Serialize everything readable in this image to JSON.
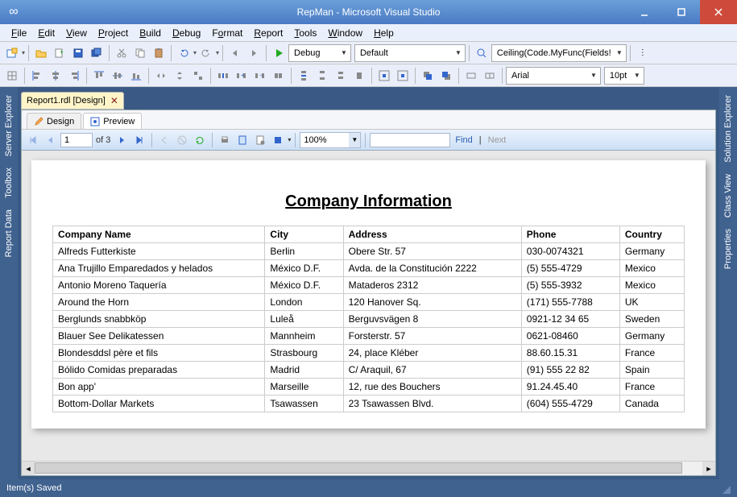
{
  "window": {
    "title": "RepMan - Microsoft Visual Studio"
  },
  "menu": [
    "File",
    "Edit",
    "View",
    "Project",
    "Build",
    "Debug",
    "Format",
    "Report",
    "Tools",
    "Window",
    "Help"
  ],
  "toolbar1": {
    "config": "Debug",
    "platform": "Default",
    "expr": "Ceiling(Code.MyFunc(Fields!Ch"
  },
  "toolbar2": {
    "font": "Arial",
    "size": "10pt"
  },
  "leftTabs": [
    "Server Explorer",
    "Toolbox",
    "Report Data"
  ],
  "rightTabs": [
    "Solution Explorer",
    "Class View",
    "Properties"
  ],
  "docTab": {
    "label": "Report1.rdl [Design]"
  },
  "innerTabs": {
    "design": "Design",
    "preview": "Preview"
  },
  "rptNav": {
    "page": "1",
    "of": "of  3",
    "zoom": "100%",
    "find": "Find",
    "next": "Next"
  },
  "report": {
    "title": "Company Information",
    "columns": [
      "Company Name",
      "City",
      "Address",
      "Phone",
      "Country"
    ],
    "rows": [
      [
        "Alfreds Futterkiste",
        "Berlin",
        "Obere Str. 57",
        "030-0074321",
        "Germany"
      ],
      [
        "Ana Trujillo Emparedados y helados",
        "México D.F.",
        "Avda. de la Constitución 2222",
        "(5) 555-4729",
        "Mexico"
      ],
      [
        "Antonio Moreno Taquería",
        "México D.F.",
        "Mataderos 2312",
        "(5) 555-3932",
        "Mexico"
      ],
      [
        "Around the Horn",
        "London",
        "120 Hanover Sq.",
        "(171) 555-7788",
        "UK"
      ],
      [
        "Berglunds snabbköp",
        "Luleå",
        "Berguvsvägen  8",
        "0921-12 34 65",
        "Sweden"
      ],
      [
        "Blauer See Delikatessen",
        "Mannheim",
        "Forsterstr. 57",
        "0621-08460",
        "Germany"
      ],
      [
        "Blondesddsl père et fils",
        "Strasbourg",
        "24, place Kléber",
        "88.60.15.31",
        "France"
      ],
      [
        "Bólido Comidas preparadas",
        "Madrid",
        "C/ Araquil, 67",
        "(91) 555 22 82",
        "Spain"
      ],
      [
        "Bon app'",
        "Marseille",
        "12, rue des Bouchers",
        "91.24.45.40",
        "France"
      ],
      [
        "Bottom-Dollar Markets",
        "Tsawassen",
        "23 Tsawassen Blvd.",
        "(604) 555-4729",
        "Canada"
      ]
    ]
  },
  "status": "Item(s) Saved"
}
